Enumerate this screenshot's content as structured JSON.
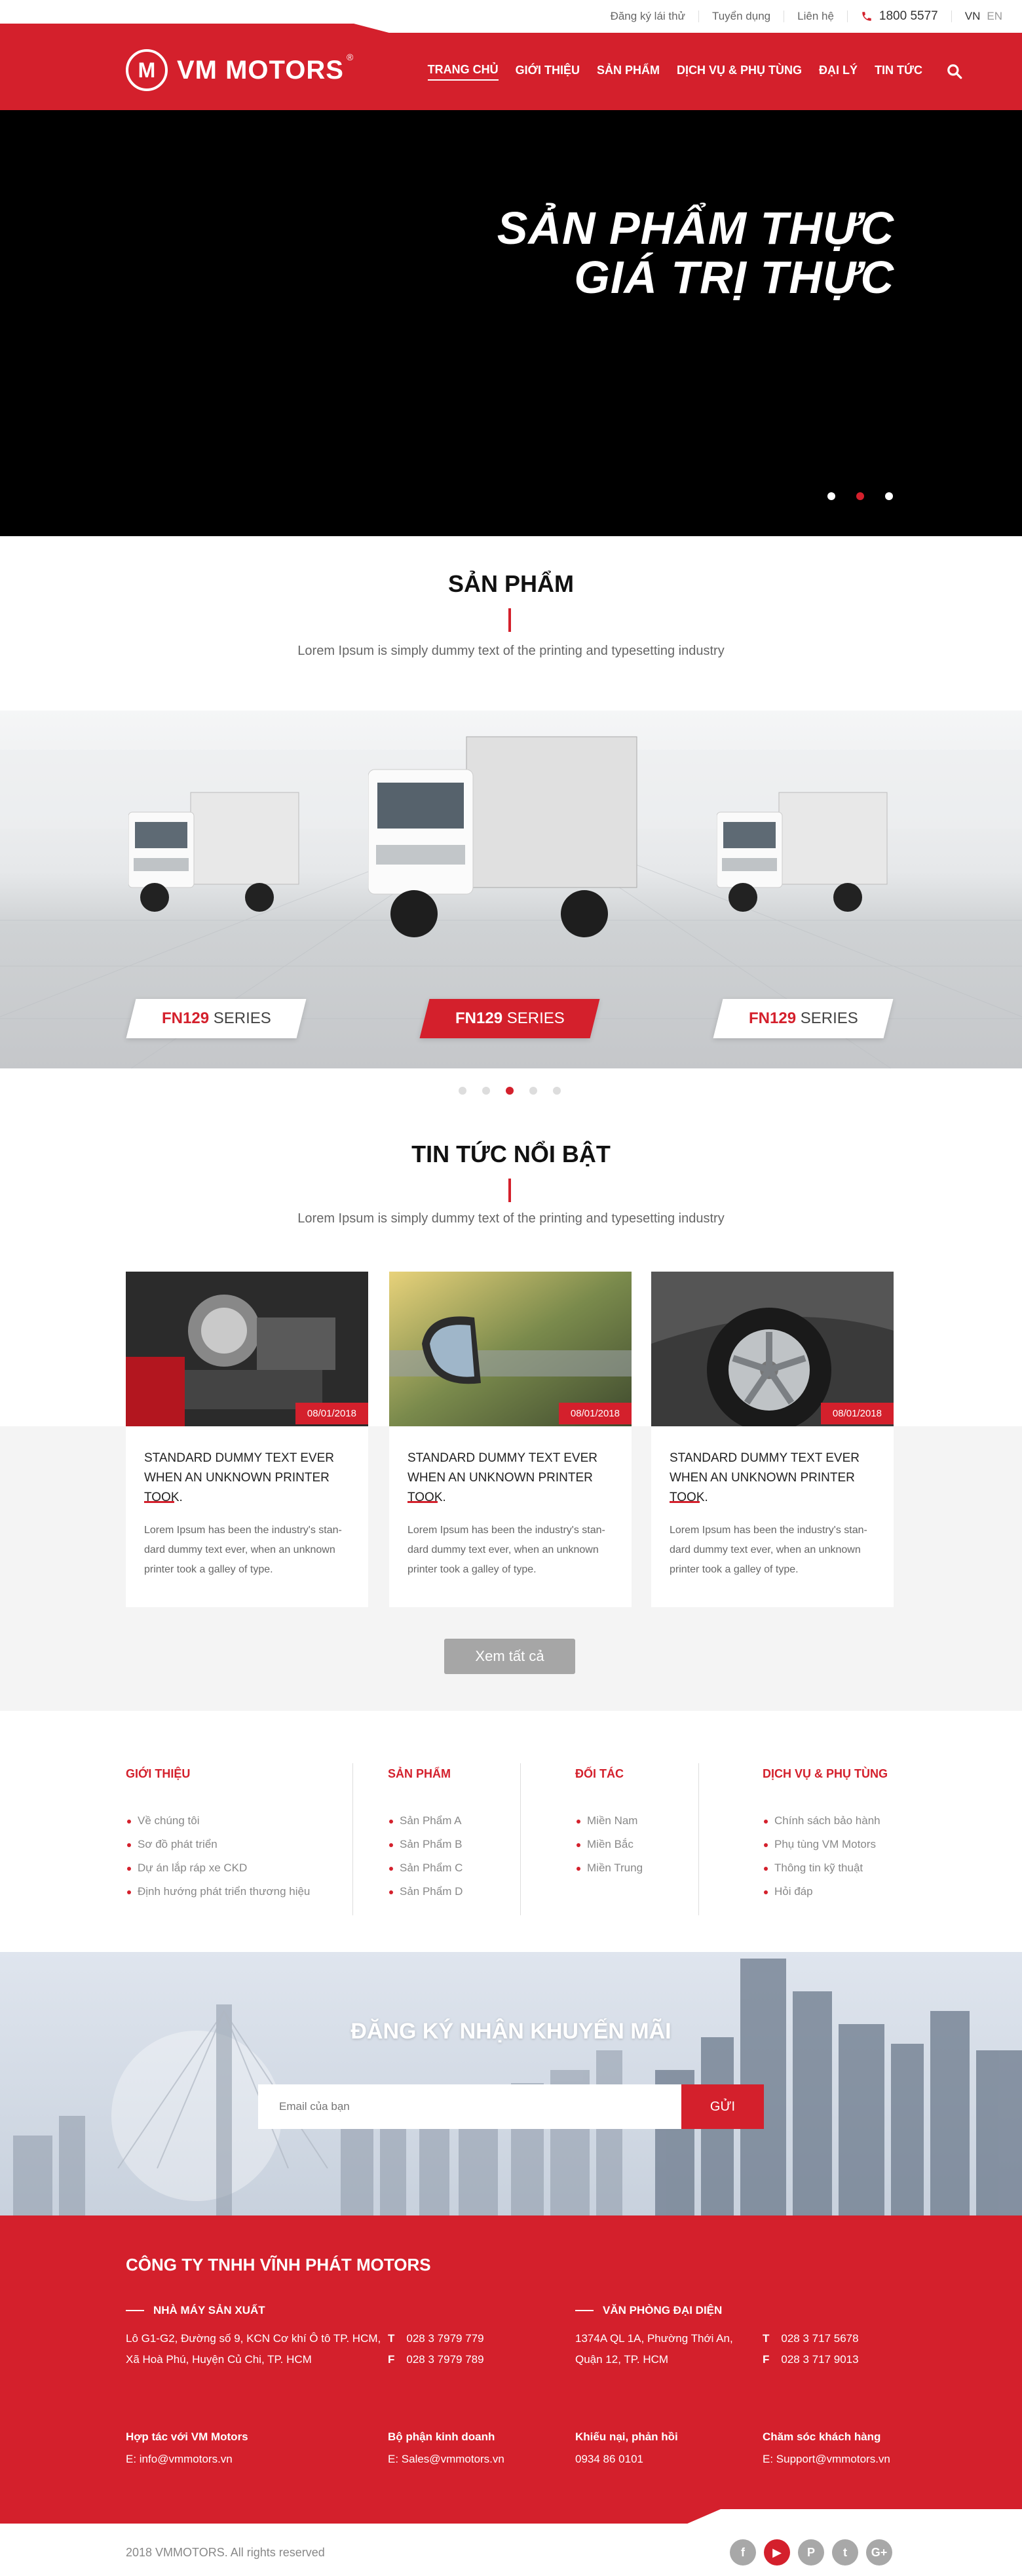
{
  "topbar": {
    "links": [
      "Đăng ký lái thử",
      "Tuyển dụng",
      "Liên hệ"
    ],
    "phone": "1800 5577",
    "lang_vn": "VN",
    "lang_en": "EN"
  },
  "header": {
    "logo_mark": "M",
    "logo_text": "VM MOTORS",
    "logo_reg": "®",
    "nav": [
      "TRANG CHỦ",
      "GIỚI THIỆU",
      "SẢN PHẨM",
      "DỊCH VỤ & PHỤ TÙNG",
      "ĐẠI LÝ",
      "TIN TỨC"
    ],
    "active_nav": "TRANG CHỦ"
  },
  "hero": {
    "line1": "SẢN PHẨM THỰC",
    "line2": "GIÁ TRỊ THỰC",
    "slides": 3,
    "active_slide": 2
  },
  "products": {
    "title": "SẢN PHẨM",
    "subtitle": "Lorem Ipsum is simply dummy text of the printing and typesetting industry",
    "items": [
      {
        "model": "FN129",
        "suffix": " SERIES"
      },
      {
        "model": "FN129",
        "suffix": " SERIES"
      },
      {
        "model": "FN129",
        "suffix": " SERIES"
      }
    ],
    "pages": 5,
    "active_page": 3
  },
  "news": {
    "title": "TIN TỨC NỔI BẬT",
    "subtitle": "Lorem Ipsum is simply dummy text of the printing and typesetting industry",
    "cards": [
      {
        "date": "08/01/2018",
        "title": "STANDARD DUMMY TEXT EVER WHEN AN UNKNOWN PRINTER TOOK.",
        "text": "Lorem Ipsum has been the industry's stan-dard dummy text ever, when an unknown printer took a galley of type."
      },
      {
        "date": "08/01/2018",
        "title": "STANDARD DUMMY TEXT EVER WHEN AN UNKNOWN PRINTER TOOK.",
        "text": "Lorem Ipsum has been the industry's stan-dard dummy text ever, when an unknown printer took a galley of type."
      },
      {
        "date": "08/01/2018",
        "title": "STANDARD DUMMY TEXT EVER WHEN AN UNKNOWN PRINTER TOOK.",
        "text": "Lorem Ipsum has been the industry's stan-dard dummy text ever, when an unknown printer took a galley of type."
      }
    ],
    "more_label": "Xem tất cả"
  },
  "links": {
    "cols": [
      {
        "heading": "GIỚI THIỆU",
        "items": [
          "Về chúng tôi",
          "Sơ đồ phát triển",
          "Dự án lắp ráp xe CKD",
          "Định hướng phát triển thương hiệu"
        ]
      },
      {
        "heading": "SẢN PHẨM",
        "items": [
          "Sản Phẩm A",
          "Sản Phẩm B",
          "Sản Phẩm C",
          "Sản Phẩm D"
        ]
      },
      {
        "heading": "ĐỐI TÁC",
        "items": [
          "Miền Nam",
          "Miền Bắc",
          "Miền Trung"
        ]
      },
      {
        "heading": "DỊCH VỤ & PHỤ TÙNG",
        "items": [
          "Chính sách bảo hành",
          "Phụ tùng VM Motors",
          "Thông tin kỹ thuật",
          "Hỏi đáp"
        ]
      }
    ]
  },
  "subscribe": {
    "title": "ĐĂNG KÝ NHẬN KHUYẾN MÃI",
    "placeholder": "Email của bạn",
    "button": "GỬI"
  },
  "footer": {
    "company": "CÔNG TY TNHH VĨNH PHÁT MOTORS",
    "factory_heading": "NHÀ MÁY SẢN XUẤT",
    "factory_addr1": "Lô G1-G2, Đường số 9, KCN Cơ khí Ô tô TP. HCM,",
    "factory_addr2": "Xã Hoà Phú, Huyện Củ Chi, TP. HCM",
    "factory_t": "028 3 7979 779",
    "factory_f": "028 3 7979 789",
    "office_heading": "VĂN PHÒNG ĐẠI DIỆN",
    "office_addr1": "1374A QL 1A, Phường Thới An,",
    "office_addr2": "Quận 12, TP. HCM",
    "office_t": "028 3 717 5678",
    "office_f": "028 3 717 9013",
    "t_label": "T",
    "f_label": "F",
    "contacts": [
      {
        "heading": "Hợp tác với VM Motors",
        "value": "E: info@vmmotors.vn"
      },
      {
        "heading": "Bộ phận kinh doanh",
        "value": "E: Sales@vmmotors.vn"
      },
      {
        "heading": "Khiếu nại, phản hồi",
        "value": "0934 86 0101"
      },
      {
        "heading": "Chăm sóc khách hàng",
        "value": "E: Support@vmmotors.vn"
      }
    ],
    "copyright": "2018 VMMOTORS. All rights reserved",
    "social": [
      {
        "icon": "facebook-icon",
        "glyph": "f"
      },
      {
        "icon": "youtube-icon",
        "glyph": "▶"
      },
      {
        "icon": "pinterest-icon",
        "glyph": "P"
      },
      {
        "icon": "twitter-icon",
        "glyph": "t"
      },
      {
        "icon": "google-plus-icon",
        "glyph": "G+"
      }
    ]
  },
  "colors": {
    "brand": "#d4202c",
    "button_gray": "#a6a6a6"
  }
}
